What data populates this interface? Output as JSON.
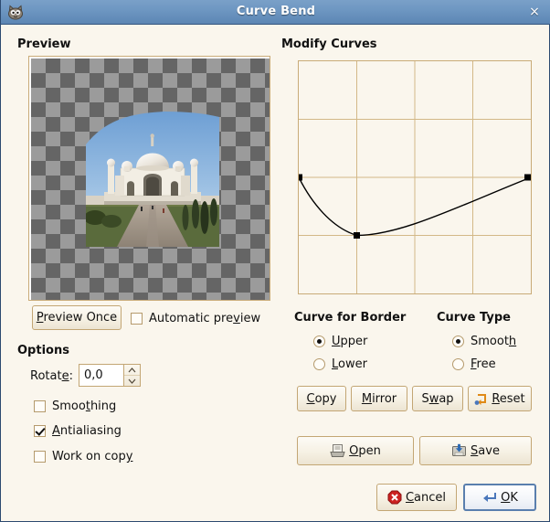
{
  "window": {
    "title": "Curve Bend",
    "icon": "gimp-wilber-icon",
    "close_label": "×",
    "background_color": "#faf6ed",
    "titlebar_color": "#6e97c2",
    "border_color": "#2c4a70"
  },
  "preview": {
    "heading": "Preview",
    "image_alt": "taj-mahal-bent-preview",
    "preview_once_button": "Preview Once",
    "preview_once_mnemonic": "P",
    "automatic_preview": {
      "label_before": "Automatic pre",
      "label_mnemonic": "v",
      "label_after": "iew",
      "checked": false
    },
    "checker_light": "#9b9b9b",
    "checker_dark": "#656565"
  },
  "options": {
    "heading": "Options",
    "rotate": {
      "label_before": "Rotat",
      "label_mnemonic": "e",
      "label_after": ":",
      "value": "0,0",
      "up_icon": "chevron-up-icon",
      "down_icon": "chevron-down-icon"
    },
    "checkboxes": [
      {
        "name": "smoothing",
        "label_before": "Smoo",
        "label_mnemonic": "t",
        "label_after": "hing",
        "checked": false
      },
      {
        "name": "antialiasing",
        "label_before": "",
        "label_mnemonic": "A",
        "label_after": "ntialiasing",
        "checked": true
      },
      {
        "name": "work-on-copy",
        "label_before": "Work on cop",
        "label_mnemonic": "y",
        "label_after": "",
        "checked": false
      }
    ]
  },
  "modify_curves": {
    "heading": "Modify Curves",
    "grid": {
      "columns": 4,
      "rows": 4,
      "grid_color": "#d3b887",
      "curve_color": "#000000",
      "point_color": "#000000"
    },
    "curve_points": [
      {
        "x": 0.0,
        "y": 0.5
      },
      {
        "x": 0.25,
        "y": 0.75
      },
      {
        "x": 1.0,
        "y": 0.5
      }
    ],
    "curve_for_border": {
      "heading": "Curve for Border",
      "options": [
        {
          "name": "upper",
          "label_mnemonic": "U",
          "label_after": "pper",
          "selected": true
        },
        {
          "name": "lower",
          "label_mnemonic": "L",
          "label_after": "ower",
          "selected": false
        }
      ]
    },
    "curve_type": {
      "heading": "Curve Type",
      "options": [
        {
          "name": "smooth",
          "label_before": "Smoot",
          "label_mnemonic": "h",
          "label_after": "",
          "selected": true
        },
        {
          "name": "free",
          "label_before": "",
          "label_mnemonic": "F",
          "label_after": "ree",
          "selected": false
        }
      ]
    },
    "tool_buttons": [
      {
        "name": "copy",
        "label_before": "",
        "label_mnemonic": "C",
        "label_after": "opy",
        "icon": ""
      },
      {
        "name": "mirror",
        "label_before": "",
        "label_mnemonic": "M",
        "label_after": "irror",
        "icon": ""
      },
      {
        "name": "swap",
        "label_before": "S",
        "label_mnemonic": "w",
        "label_after": "ap",
        "icon": ""
      },
      {
        "name": "reset",
        "label_before": "",
        "label_mnemonic": "R",
        "label_after": "eset",
        "icon": "revert-icon"
      }
    ],
    "file_buttons": [
      {
        "name": "open",
        "label_before": "",
        "label_mnemonic": "O",
        "label_after": "pen",
        "icon": "folder-open-icon"
      },
      {
        "name": "save",
        "label_before": "",
        "label_mnemonic": "S",
        "label_after": "ave",
        "icon": "floppy-save-icon"
      }
    ]
  },
  "dialog_actions": [
    {
      "name": "cancel",
      "label_before": "",
      "label_mnemonic": "C",
      "label_after": "ancel",
      "icon": "cancel-icon",
      "default": false
    },
    {
      "name": "ok",
      "label_before": "",
      "label_mnemonic": "O",
      "label_after": "K",
      "icon": "enter-icon",
      "default": true
    }
  ]
}
